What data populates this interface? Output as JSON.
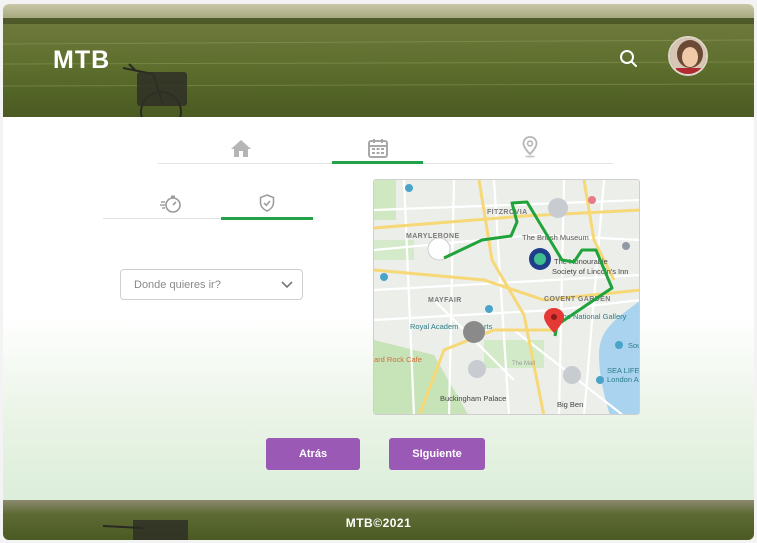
{
  "header": {
    "logo": "MTB",
    "search_icon": "search-icon",
    "avatar": "user-avatar"
  },
  "nav": {
    "tabs": [
      {
        "icon": "home-icon",
        "active": false
      },
      {
        "icon": "calendar-icon",
        "active": true
      },
      {
        "icon": "location-pin-icon",
        "active": false
      }
    ]
  },
  "subnav": {
    "tabs": [
      {
        "icon": "stopwatch-icon",
        "active": false
      },
      {
        "icon": "shield-check-icon",
        "active": true
      }
    ]
  },
  "destination": {
    "placeholder": "Donde quieres ir?"
  },
  "map": {
    "labels": {
      "marylebone": "MARYLEBONE",
      "fitzrovia": "FITZROVIA",
      "mayfair": "MAYFAIR",
      "covent_garden": "COVENT GARDEN",
      "british_museum": "The British Museum",
      "lincolns_inn_1": "The Honourable",
      "lincolns_inn_2": "Society of Lincoln's Inn",
      "royal_academy": "Royal Academ",
      "royal_academy_tail": "rts",
      "national_gallery": "The National Gallery",
      "hard_rock": "ard Rock Cafe",
      "buckingham": "Buckingham Palace",
      "big_ben": "Big Ben",
      "sea_life_1": "SEA LIFE",
      "sea_life_2": "London A",
      "the_mall": "The Mall",
      "sou": "Sou"
    }
  },
  "actions": {
    "back_label": "Atrás",
    "next_label": "SIguiente"
  },
  "footer": {
    "copyright": "MTB©2021"
  },
  "colors": {
    "accent_green": "#22a34a",
    "button_purple": "#9b59b6",
    "route_green": "#1fa33a",
    "pin_red": "#e53935"
  }
}
